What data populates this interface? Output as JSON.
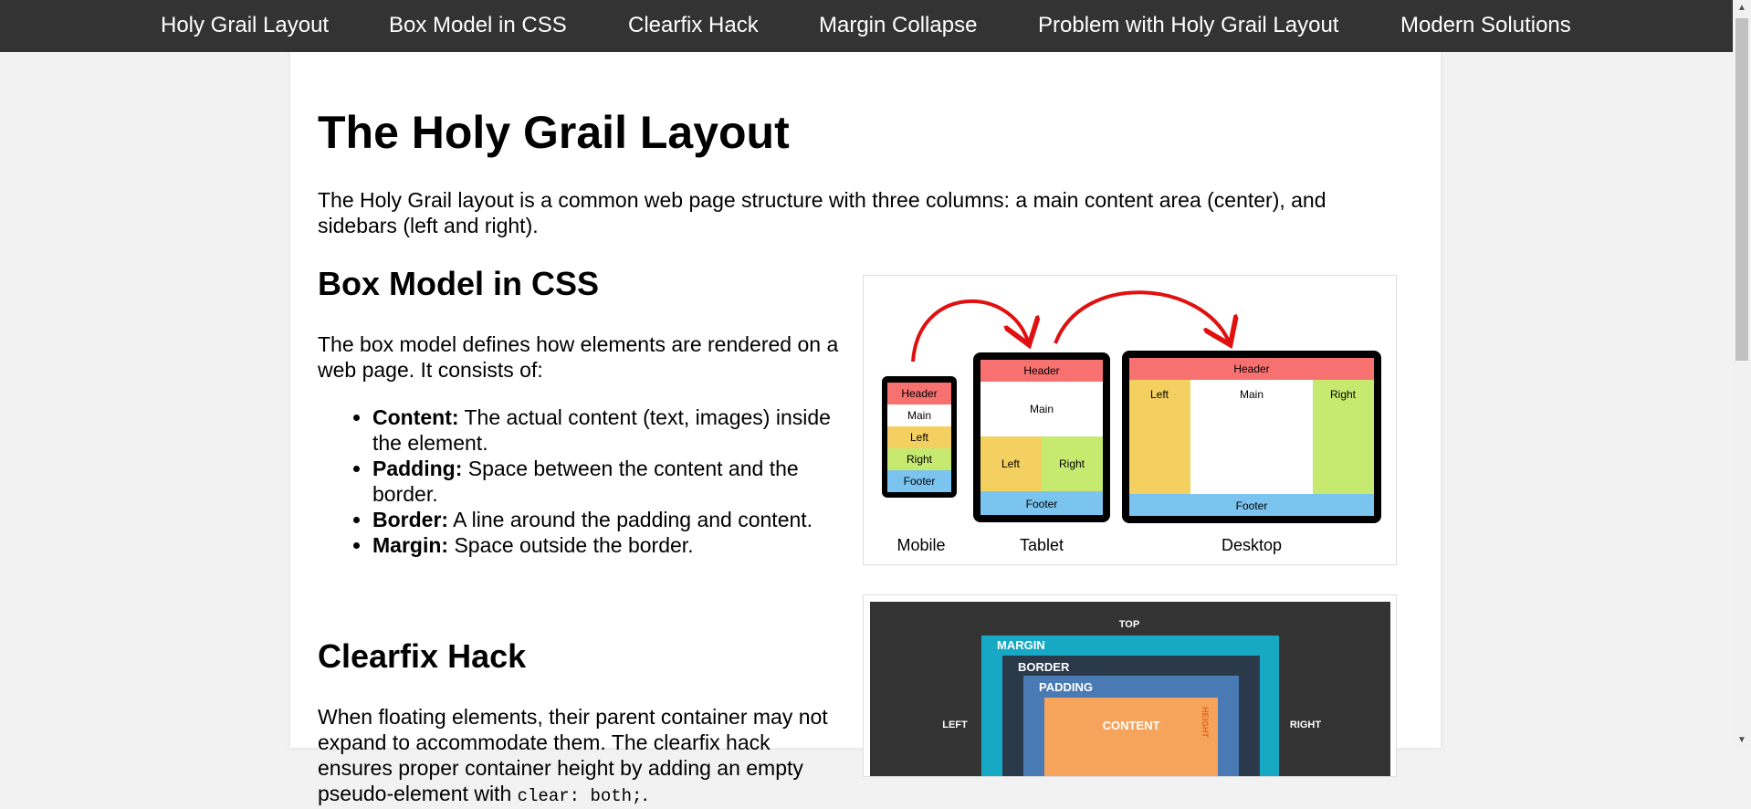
{
  "nav": {
    "items": [
      {
        "label": "Holy Grail Layout"
      },
      {
        "label": "Box Model in CSS"
      },
      {
        "label": "Clearfix Hack"
      },
      {
        "label": "Margin Collapse"
      },
      {
        "label": "Problem with Holy Grail Layout"
      },
      {
        "label": "Modern Solutions"
      }
    ]
  },
  "page": {
    "title": "The Holy Grail Layout",
    "intro": "The Holy Grail layout is a common web page structure with three columns: a main content area (center), and sidebars (left and right)."
  },
  "box_model": {
    "heading": "Box Model in CSS",
    "intro": "The box model defines how elements are rendered on a web page. It consists of:",
    "items": [
      {
        "term": "Content:",
        "desc": " The actual content (text, images) inside the element."
      },
      {
        "term": "Padding:",
        "desc": " Space between the content and the border."
      },
      {
        "term": "Border:",
        "desc": " A line around the padding and content."
      },
      {
        "term": "Margin:",
        "desc": " Space outside the border."
      }
    ]
  },
  "clearfix": {
    "heading": "Clearfix Hack",
    "text_before": "When floating elements, their parent container may not expand to accommodate them. The clearfix hack ensures proper container height by adding an empty pseudo-element with ",
    "code": "clear: both;",
    "text_after": "."
  },
  "layout_figure": {
    "captions": {
      "mobile": "Mobile",
      "tablet": "Tablet",
      "desktop": "Desktop"
    },
    "labels": {
      "header": "Header",
      "main": "Main",
      "left": "Left",
      "right": "Right",
      "footer": "Footer"
    },
    "colors": {
      "header": "#f87171",
      "main": "#ffffff",
      "left": "#f4d060",
      "right": "#c6ea70",
      "footer": "#7cc4f0",
      "frame": "#000000",
      "arrow": "#e01010"
    }
  },
  "box_model_figure": {
    "labels": {
      "top": "TOP",
      "left": "LEFT",
      "right": "RIGHT",
      "margin": "MARGIN",
      "border": "BORDER",
      "padding": "PADDING",
      "content": "CONTENT",
      "height": "HEIGHT"
    },
    "colors": {
      "background": "#333333",
      "margin": "#17a8c4",
      "border": "#2b3a4a",
      "padding": "#4a7ab4",
      "content": "#f6a45c",
      "height_text": "#e8641c"
    }
  },
  "theme": {
    "nav_bg": "#333333",
    "page_bg": "#f2f2f2",
    "container_bg": "#ffffff"
  }
}
